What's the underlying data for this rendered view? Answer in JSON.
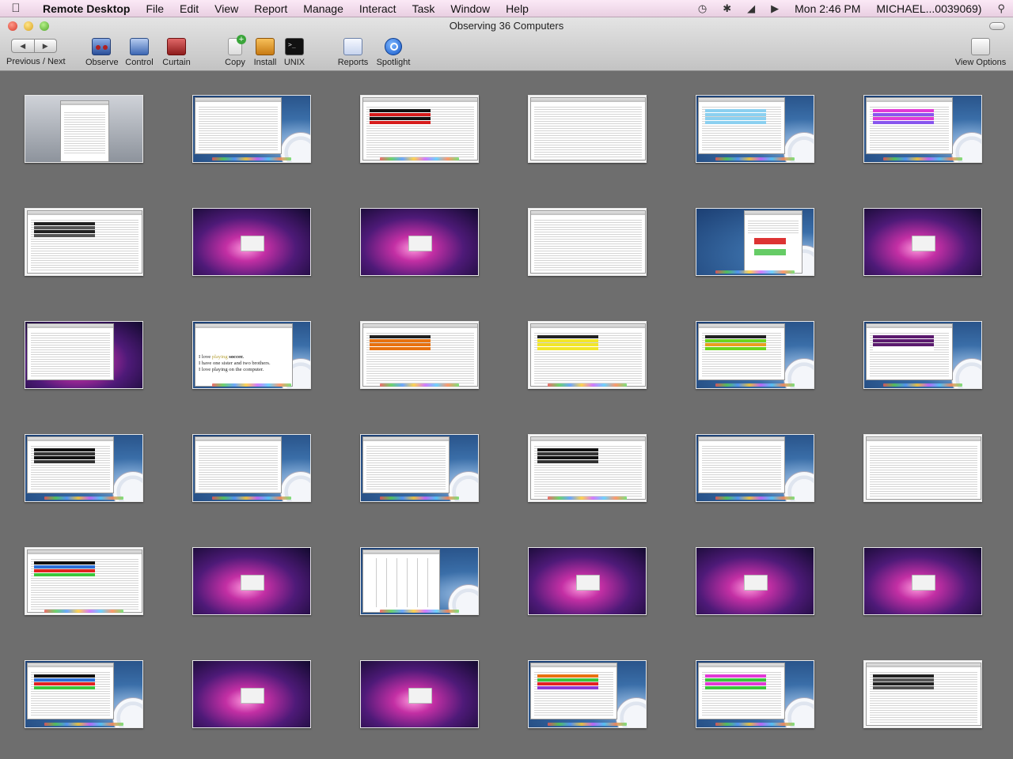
{
  "menubar": {
    "app_name": "Remote Desktop",
    "items": [
      "File",
      "Edit",
      "View",
      "Report",
      "Manage",
      "Interact",
      "Task",
      "Window",
      "Help"
    ],
    "clock": "Mon 2:46 PM",
    "user": "MICHAEL...0039069)"
  },
  "window": {
    "title": "Observing 36 Computers"
  },
  "toolbar": {
    "prev_next_label": "Previous / Next",
    "observe_label": "Observe",
    "control_label": "Control",
    "curtain_label": "Curtain",
    "copy_label": "Copy",
    "install_label": "Install",
    "unix_label": "UNIX",
    "reports_label": "Reports",
    "spotlight_label": "Spotlight",
    "view_options_label": "View Options"
  },
  "screen_text": {
    "doc_line1_a": "I love ",
    "doc_line1_b": "playing",
    "doc_line1_c": " soccer.",
    "doc_line2": "I have one sister and two brothers.",
    "doc_line3": "I love playing on the computer."
  },
  "screens": [
    {
      "bg": "gray",
      "content": "doc"
    },
    {
      "bg": "blue",
      "content": "sheet-small"
    },
    {
      "bg": "white",
      "content": "sheet-red"
    },
    {
      "bg": "white",
      "content": "sheet-plain"
    },
    {
      "bg": "blue",
      "content": "sheet-lightblue"
    },
    {
      "bg": "blue",
      "content": "sheet-magenta"
    },
    {
      "bg": "white",
      "content": "sheet-dark"
    },
    {
      "bg": "purple",
      "content": "login"
    },
    {
      "bg": "purple",
      "content": "login"
    },
    {
      "bg": "white",
      "content": "sheet-plain"
    },
    {
      "bg": "blue",
      "content": "browser"
    },
    {
      "bg": "purple",
      "content": "login"
    },
    {
      "bg": "purple",
      "content": "sheet-plain"
    },
    {
      "bg": "blue",
      "content": "text-doc"
    },
    {
      "bg": "white",
      "content": "sheet-orange"
    },
    {
      "bg": "white",
      "content": "sheet-yellow"
    },
    {
      "bg": "blue",
      "content": "sheet-green"
    },
    {
      "bg": "blue",
      "content": "sheet-purple"
    },
    {
      "bg": "blue",
      "content": "sheet-black"
    },
    {
      "bg": "blue",
      "content": "sheet-small"
    },
    {
      "bg": "blue",
      "content": "sheet-plain"
    },
    {
      "bg": "white",
      "content": "sheet-black"
    },
    {
      "bg": "blue",
      "content": "sheet-plain"
    },
    {
      "bg": "white",
      "content": "sheet-plain"
    },
    {
      "bg": "white",
      "content": "sheet-rainbow"
    },
    {
      "bg": "purple",
      "content": "login"
    },
    {
      "bg": "blue",
      "content": "calendar"
    },
    {
      "bg": "purple",
      "content": "login"
    },
    {
      "bg": "purple",
      "content": "login"
    },
    {
      "bg": "purple",
      "content": "login"
    },
    {
      "bg": "blue",
      "content": "sheet-rainbow"
    },
    {
      "bg": "purple",
      "content": "login"
    },
    {
      "bg": "purple",
      "content": "login"
    },
    {
      "bg": "blue",
      "content": "sheet-multi"
    },
    {
      "bg": "blue",
      "content": "sheet-pink-green"
    },
    {
      "bg": "white",
      "content": "sheet-dark"
    }
  ]
}
